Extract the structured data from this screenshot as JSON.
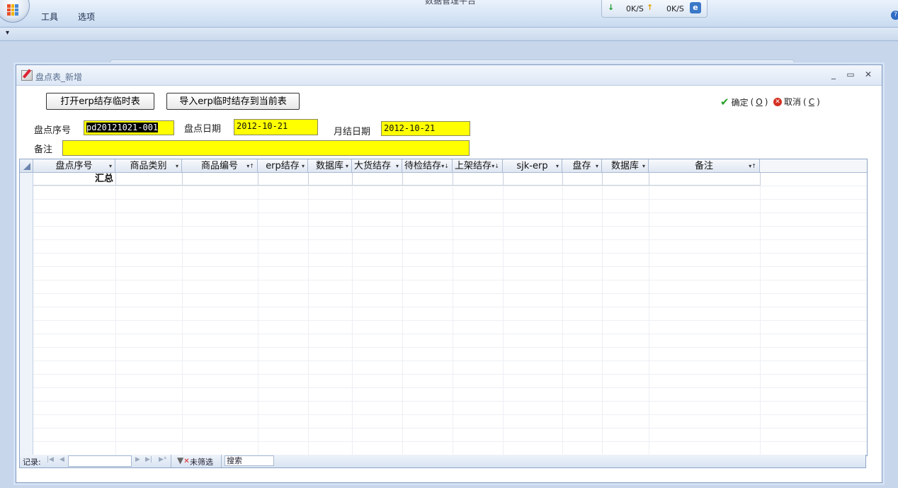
{
  "app": {
    "title": "数据管理平台",
    "menu": [
      "工具",
      "选项"
    ],
    "net": {
      "down": "0K/S",
      "up": "0K/S"
    }
  },
  "dialog": {
    "title": "盘点表_新增",
    "buttons": {
      "open_temp": "打开erp结存临时表",
      "import_temp": "导入erp临时结存到当前表"
    },
    "confirm": {
      "label": "确定",
      "key": "O"
    },
    "cancel": {
      "label": "取消",
      "key": "C"
    },
    "fields": {
      "serial_label": "盘点序号",
      "serial_value": "pd20121021-001",
      "date_label": "盘点日期",
      "date_value": "2012-10-21",
      "month_label": "月结日期",
      "month_value": "2012-10-21",
      "remark_label": "备注",
      "remark_value": ""
    }
  },
  "grid": {
    "columns": [
      "盘点序号",
      "商品类别",
      "商品编号",
      "erp结存",
      "数据库",
      "大货结存",
      "待检结存",
      "上架结存",
      "sjk-erp",
      "盘存",
      "数据库",
      "备注"
    ],
    "summary_label": "汇总"
  },
  "navbar": {
    "record_label": "记录:",
    "filter_text": "未筛选",
    "search_text": "搜索"
  }
}
